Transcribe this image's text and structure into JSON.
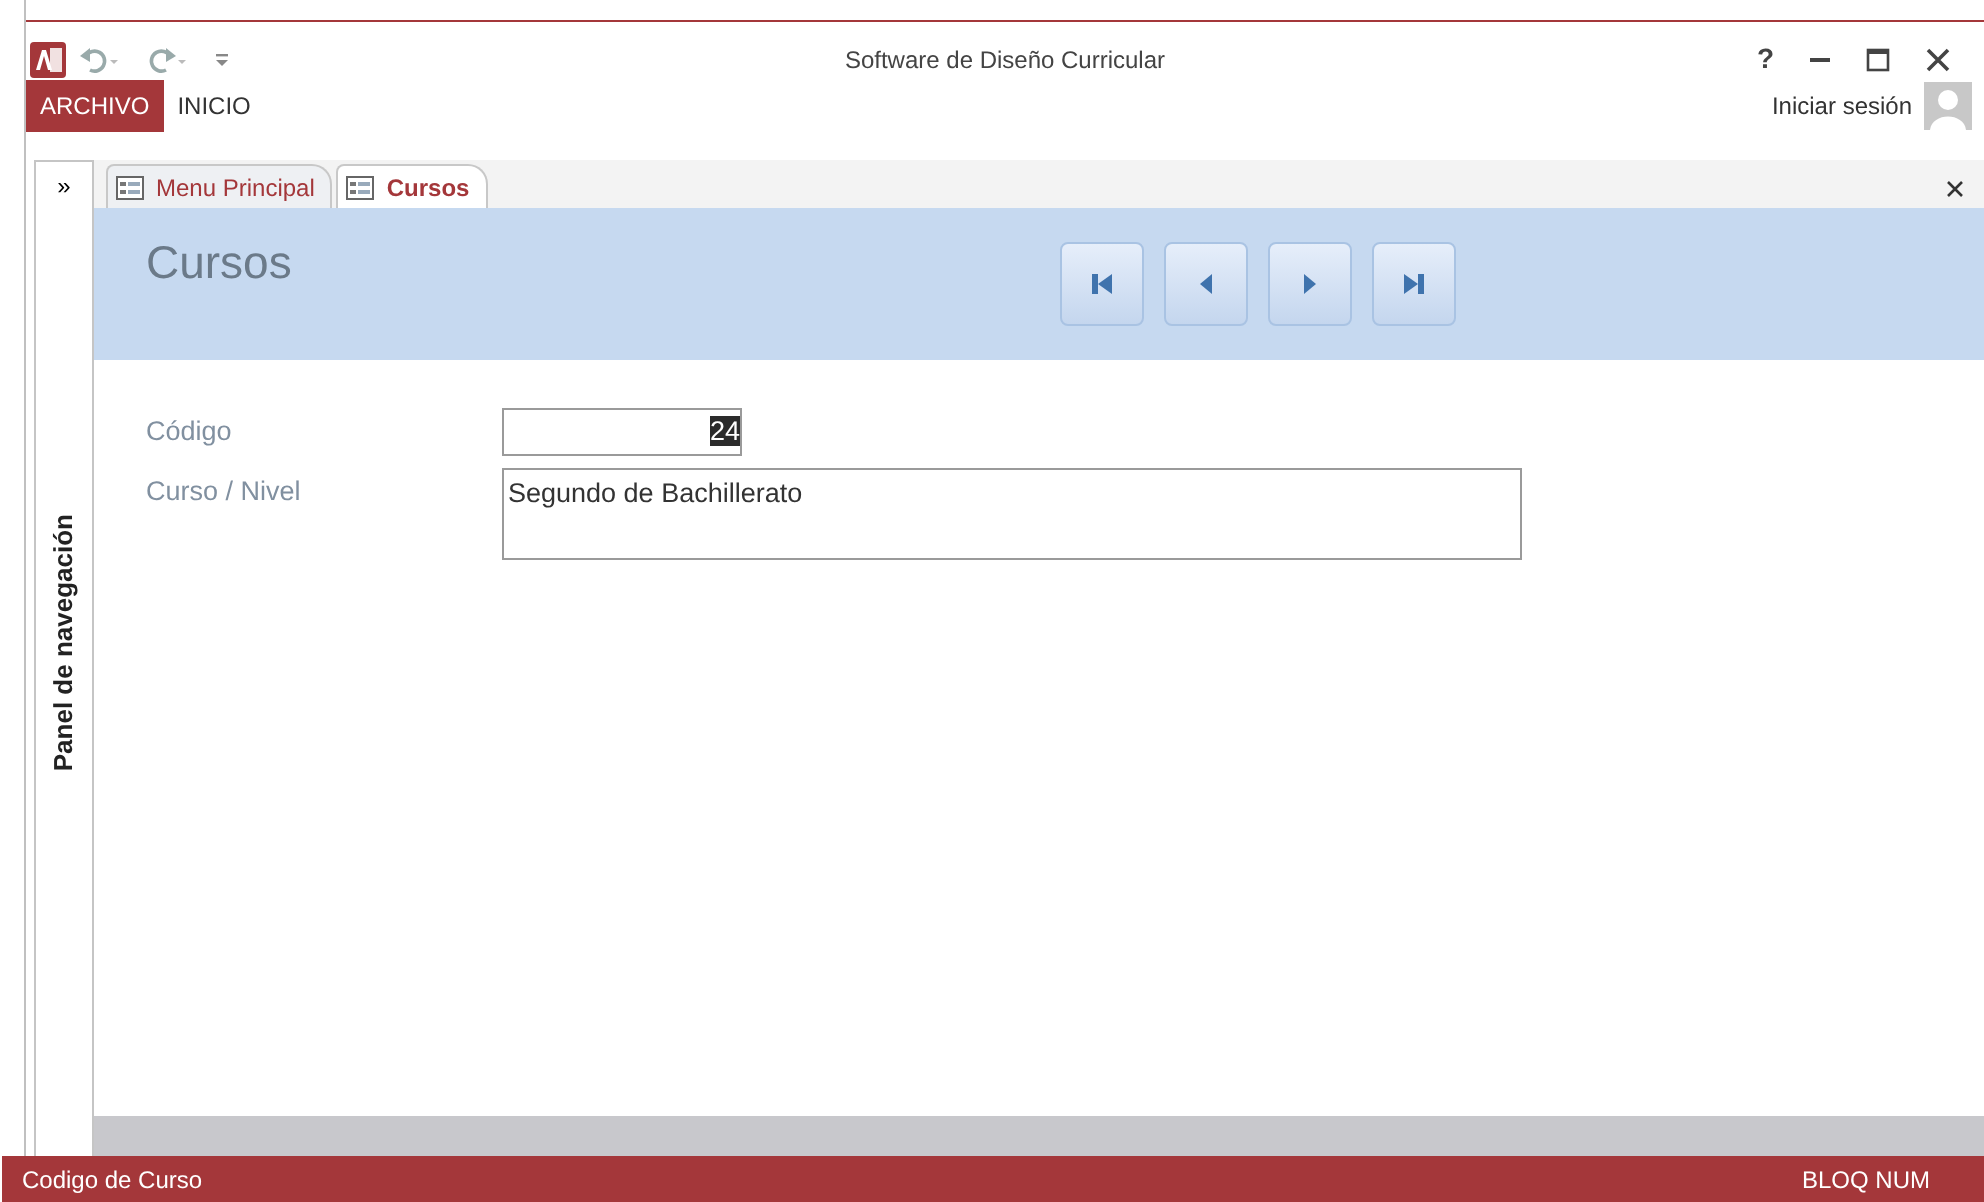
{
  "window": {
    "title": "Software de Diseño Curricular",
    "help": "?"
  },
  "ribbon_tabs": [
    {
      "label": "ARCHIVO",
      "selected": true
    },
    {
      "label": "INICIO",
      "selected": false
    }
  ],
  "account": {
    "label": "Iniciar sesión"
  },
  "navigation_pane": {
    "toggle": "»",
    "label": "Panel de navegación"
  },
  "document_tabs": [
    {
      "label": "Menu Principal",
      "selected": false
    },
    {
      "label": "Cursos",
      "selected": true
    }
  ],
  "form": {
    "title": "Cursos",
    "record_buttons": [
      {
        "kind": "first"
      },
      {
        "kind": "previous"
      },
      {
        "kind": "next"
      },
      {
        "kind": "last"
      }
    ],
    "fields": [
      {
        "label": "Código",
        "value": "24",
        "kind": "number",
        "value_selected": true
      },
      {
        "label": "Curso / Nivel",
        "value": "Segundo de Bachillerato",
        "kind": "text",
        "value_selected": false
      }
    ]
  },
  "status_bar": {
    "left": "Codigo de Curso",
    "right": "BLOQ NUM"
  }
}
